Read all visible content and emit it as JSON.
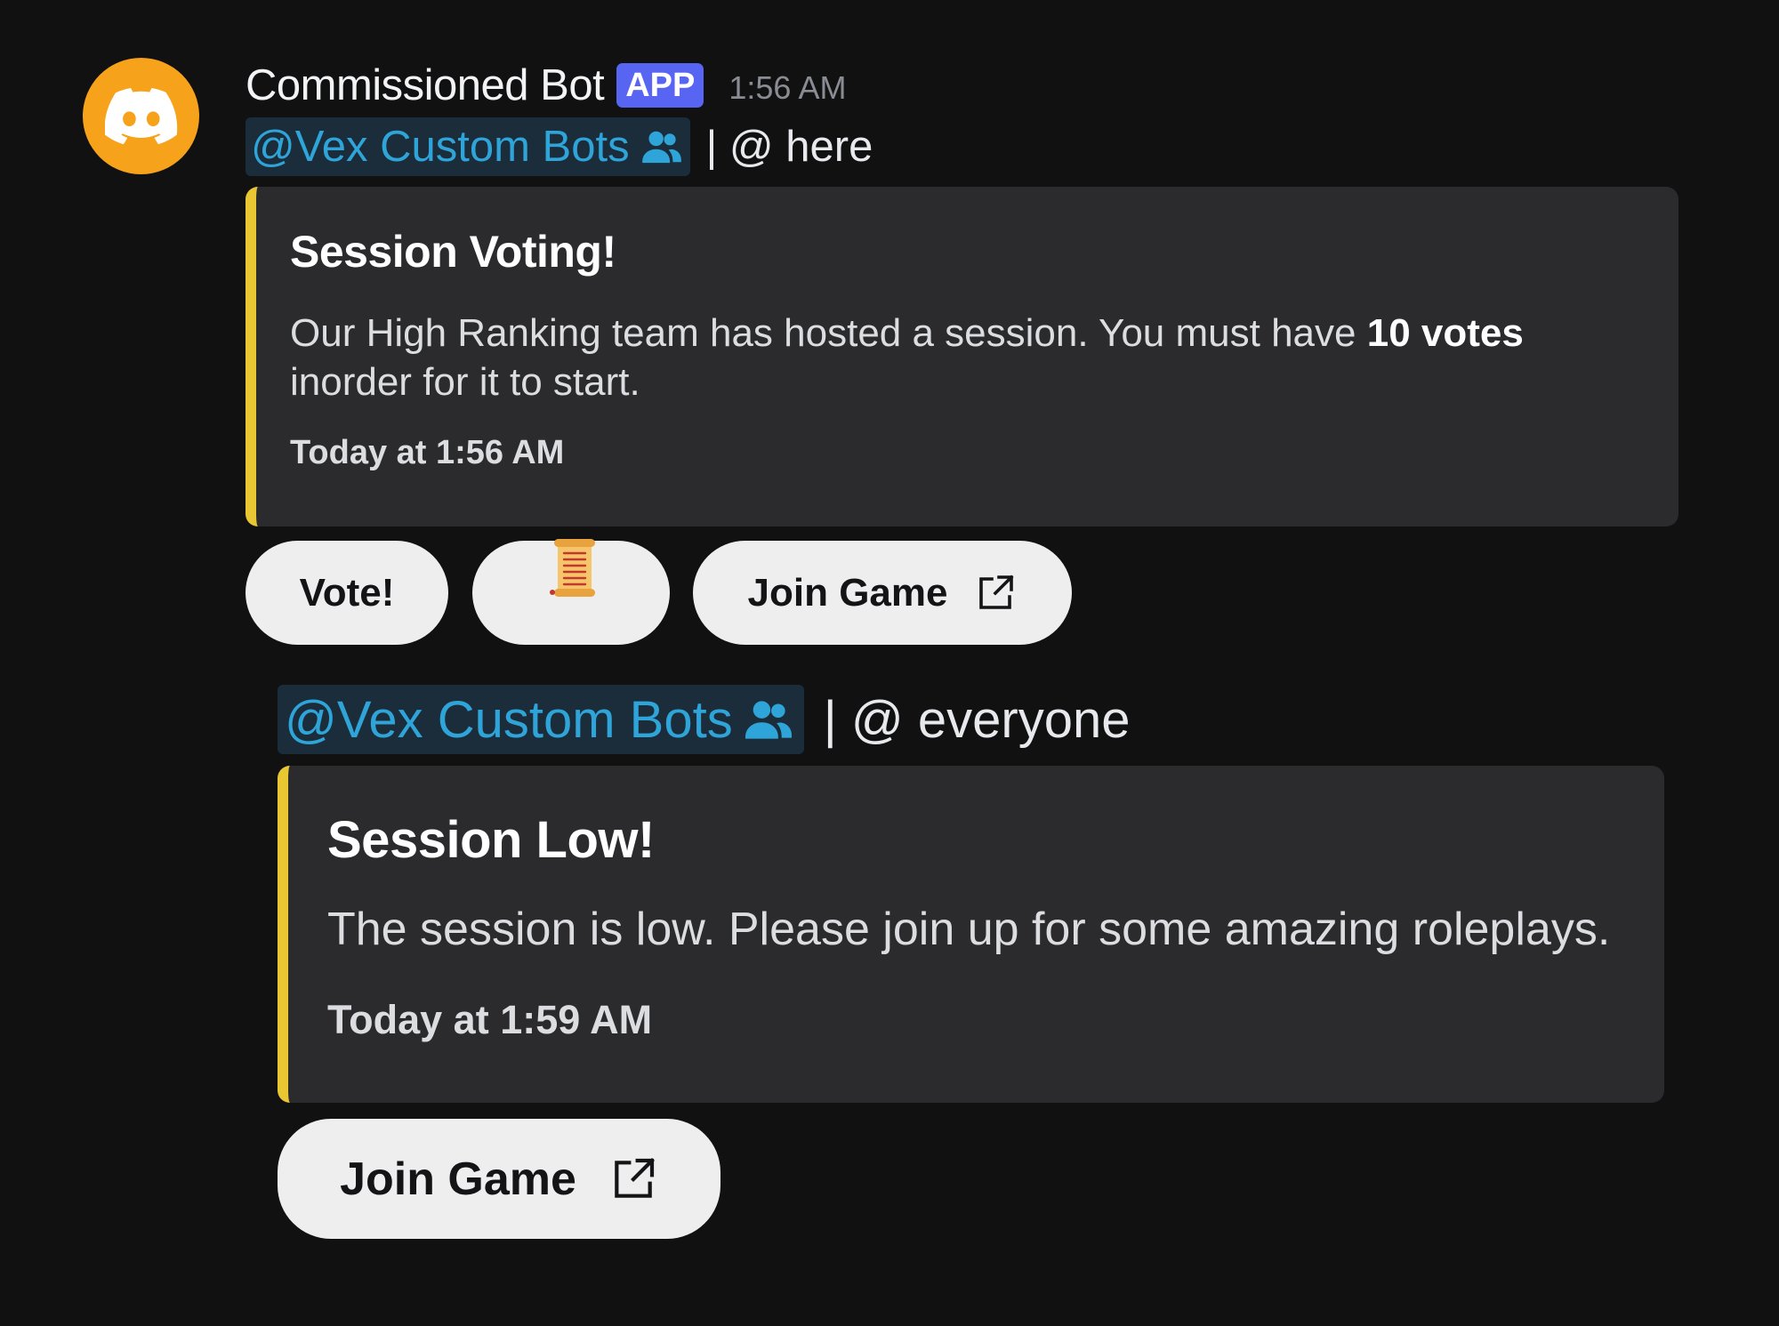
{
  "message": {
    "author": "Commissioned Bot",
    "badge": "APP",
    "timestamp": "1:56 AM",
    "avatar_icon": "discord-logo-icon",
    "avatar_color": "#f6a21b"
  },
  "first": {
    "mention": "@Vex Custom Bots",
    "rest": "| @ here",
    "embed": {
      "title": "Session Voting!",
      "desc_before": "Our High Ranking team has hosted a session. You must have ",
      "desc_bold": "10 votes",
      "desc_after": " inorder for it to start.",
      "footer": "Today at 1:56 AM",
      "accent": "#e9c733"
    },
    "buttons": {
      "vote": "Vote!",
      "scroll_icon": "scroll-icon",
      "join": "Join Game"
    }
  },
  "second": {
    "mention": "@Vex Custom Bots",
    "rest": "| @ everyone",
    "embed": {
      "title": "Session Low!",
      "desc": "The session is low. Please join up for some amazing roleplays.",
      "footer": "Today at 1:59 AM",
      "accent": "#e9c733"
    },
    "buttons": {
      "join": "Join Game"
    }
  },
  "colors": {
    "background": "#111112",
    "embed_bg": "#2b2b2e",
    "mention_text": "#2fa4d9",
    "mention_bg": "#1b2c3a",
    "app_badge": "#5865f2",
    "button_bg": "#eeeeef"
  }
}
